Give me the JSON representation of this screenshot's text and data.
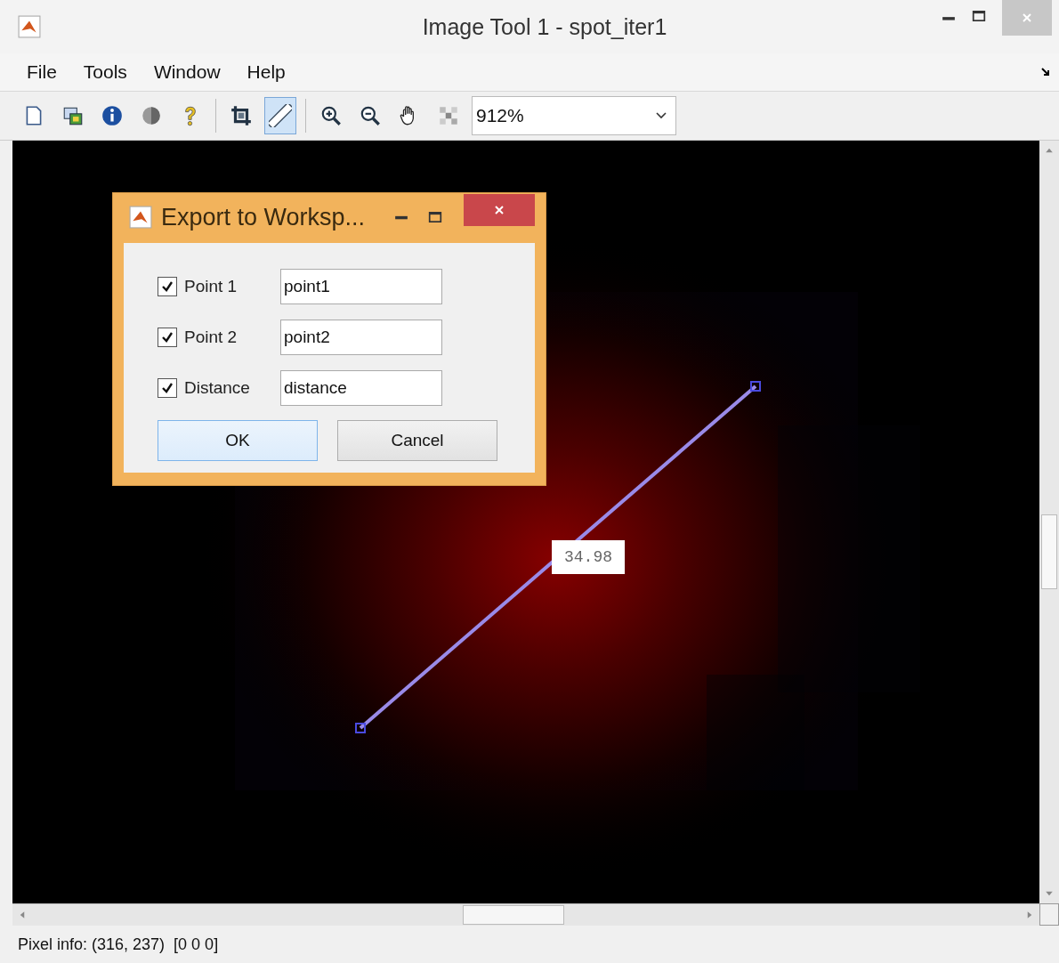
{
  "window": {
    "title": "Image Tool 1 - spot_iter1"
  },
  "menu": [
    "File",
    "Tools",
    "Window",
    "Help"
  ],
  "toolbar": {
    "tools": [
      {
        "kind": "document",
        "selected": false
      },
      {
        "kind": "export",
        "selected": false
      },
      {
        "kind": "info",
        "selected": false
      },
      {
        "kind": "contrast",
        "selected": false
      },
      {
        "kind": "help",
        "selected": false
      },
      {
        "kind": "crop",
        "selected": false
      },
      {
        "kind": "ruler",
        "selected": true
      },
      {
        "kind": "zoom-in",
        "selected": false
      },
      {
        "kind": "zoom-out",
        "selected": false
      },
      {
        "kind": "hand",
        "selected": false
      },
      {
        "kind": "pixel",
        "selected": false
      }
    ],
    "zoom": "912%"
  },
  "image": {
    "kind": "picture",
    "measurement": "34.98"
  },
  "dialog": {
    "title": "Export to Worksp...",
    "fields": [
      {
        "label": "Point 1",
        "checked": true,
        "value": "point1"
      },
      {
        "label": "Point 2",
        "checked": true,
        "value": "point2"
      },
      {
        "label": "Distance",
        "checked": true,
        "value": "distance"
      }
    ],
    "buttons": [
      {
        "label": "OK",
        "default": true
      },
      {
        "label": "Cancel",
        "default": false
      }
    ]
  },
  "status_bar": "Pixel info: (316, 237)  [0 0 0]"
}
